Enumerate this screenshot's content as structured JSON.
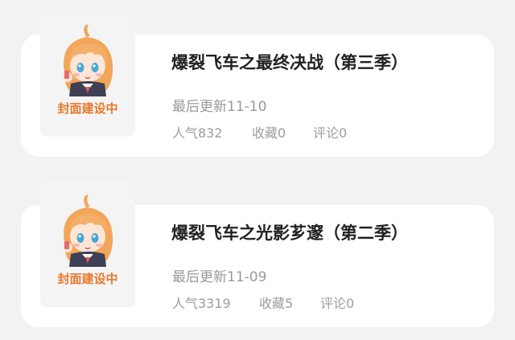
{
  "items": [
    {
      "cover_caption": "封面建设中",
      "title": "爆裂飞车之最终决战（第三季）",
      "updated": "最后更新11-10",
      "popularity": "人气832",
      "favorites": "收藏0",
      "comments": "评论0"
    },
    {
      "cover_caption": "封面建设中",
      "title": "爆裂飞车之光影芗邃（第二季）",
      "updated": "最后更新11-09",
      "popularity": "人气3319",
      "favorites": "收藏5",
      "comments": "评论0"
    }
  ],
  "colors": {
    "background": "#f2f2f2",
    "card": "#ffffff",
    "title": "#222222",
    "meta": "#999999",
    "caption": "#e8782c",
    "hair": "#f2a65a"
  },
  "icons": {
    "cover": "anime-girl-placeholder-icon"
  }
}
